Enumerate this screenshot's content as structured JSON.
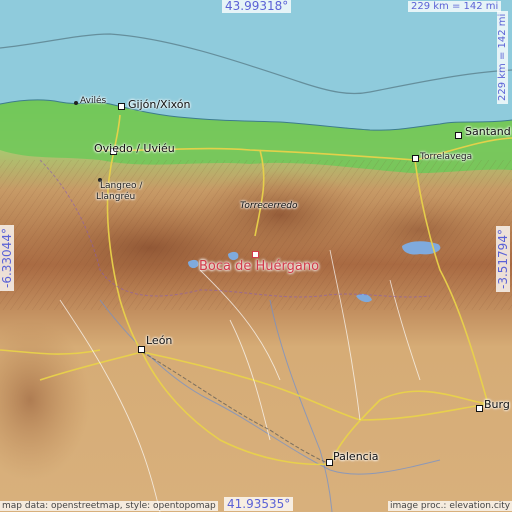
{
  "map": {
    "top_latitude": "43.99318°",
    "bottom_latitude": "41.93535°",
    "left_longitude": "-6.33044°",
    "right_longitude": "-3.51794°",
    "scale_horizontal": "229 km = 142 mi",
    "scale_vertical": "229 km = 142 mi",
    "credit_left": "map data: openstreetmap, style: opentopomap",
    "credit_right": "image proc.: elevation.city",
    "highlight_place": "Boca de Huérgano",
    "places": {
      "aviles": "Avilés",
      "gijon": "Gijón/Xixón",
      "oviedo": "Oviedo / Uviéu",
      "langreo": "Langreo /",
      "llangreu": "Llangréu",
      "torrecerredo": "Torrecerredo",
      "torrelavega": "Torrelavega",
      "santander": "Santand",
      "leon": "León",
      "palencia": "Palencia",
      "burgos": "Burg"
    },
    "colors": {
      "sea": "#8fcbdc",
      "lowland": "#7ccd5f",
      "plateau": "#d2a772",
      "mountain": "#a6663f",
      "highlight": "#d23a4a",
      "coordinate_text": "#5b62d6"
    }
  }
}
